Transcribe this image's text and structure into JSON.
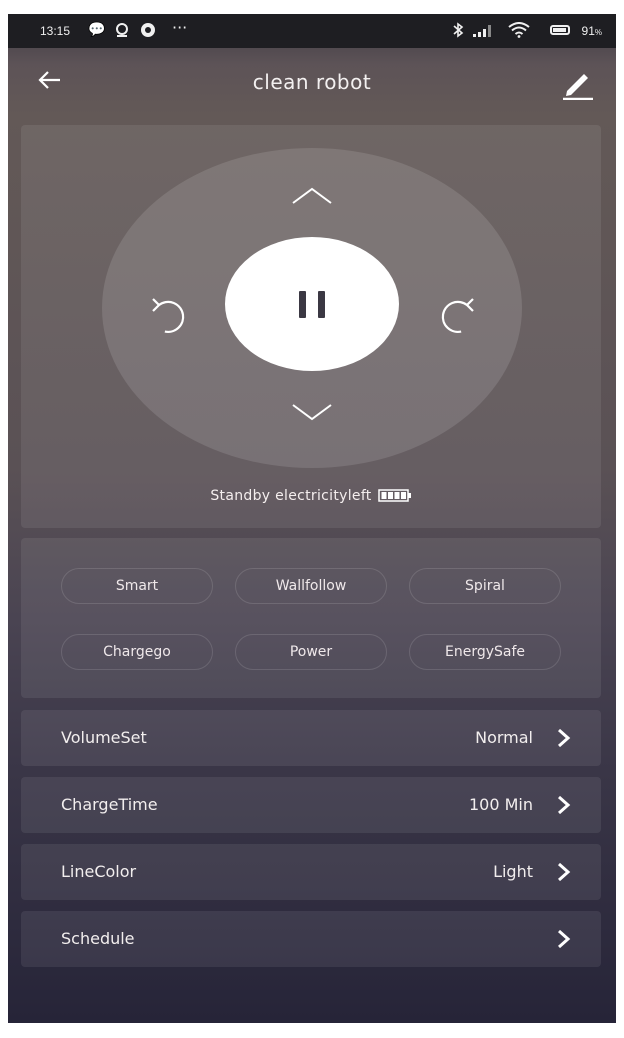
{
  "status_bar": {
    "time": "13:15",
    "battery_percent": "91",
    "icons": [
      "chat-icon",
      "notification-icon",
      "chrome-icon",
      "more-dots-icon",
      "bluetooth-icon",
      "signal-icon",
      "wifi-icon",
      "battery-icon"
    ]
  },
  "header": {
    "title": "clean robot",
    "back_icon": "back-arrow-icon",
    "edit_icon": "pencil-icon"
  },
  "control": {
    "status_text": "Standby electricityleft",
    "battery_level": 1.0,
    "buttons": [
      "up-arrow",
      "down-arrow",
      "rotate-left",
      "rotate-right",
      "pause"
    ]
  },
  "modes": [
    {
      "label": "Smart"
    },
    {
      "label": "Wallfollow"
    },
    {
      "label": "Spiral"
    },
    {
      "label": "Chargego"
    },
    {
      "label": "Power"
    },
    {
      "label": "EnergySafe"
    }
  ],
  "settings": [
    {
      "label": "VolumeSet",
      "value": "Normal"
    },
    {
      "label": "ChargeTime",
      "value": "100 Min"
    },
    {
      "label": "LineColor",
      "value": "Light"
    },
    {
      "label": "Schedule",
      "value": ""
    }
  ],
  "colors": {
    "bg_top": "#635957",
    "bg_bottom": "#262438",
    "panel": "rgba(255,255,255,0.08)",
    "text": "#f2eeee"
  }
}
